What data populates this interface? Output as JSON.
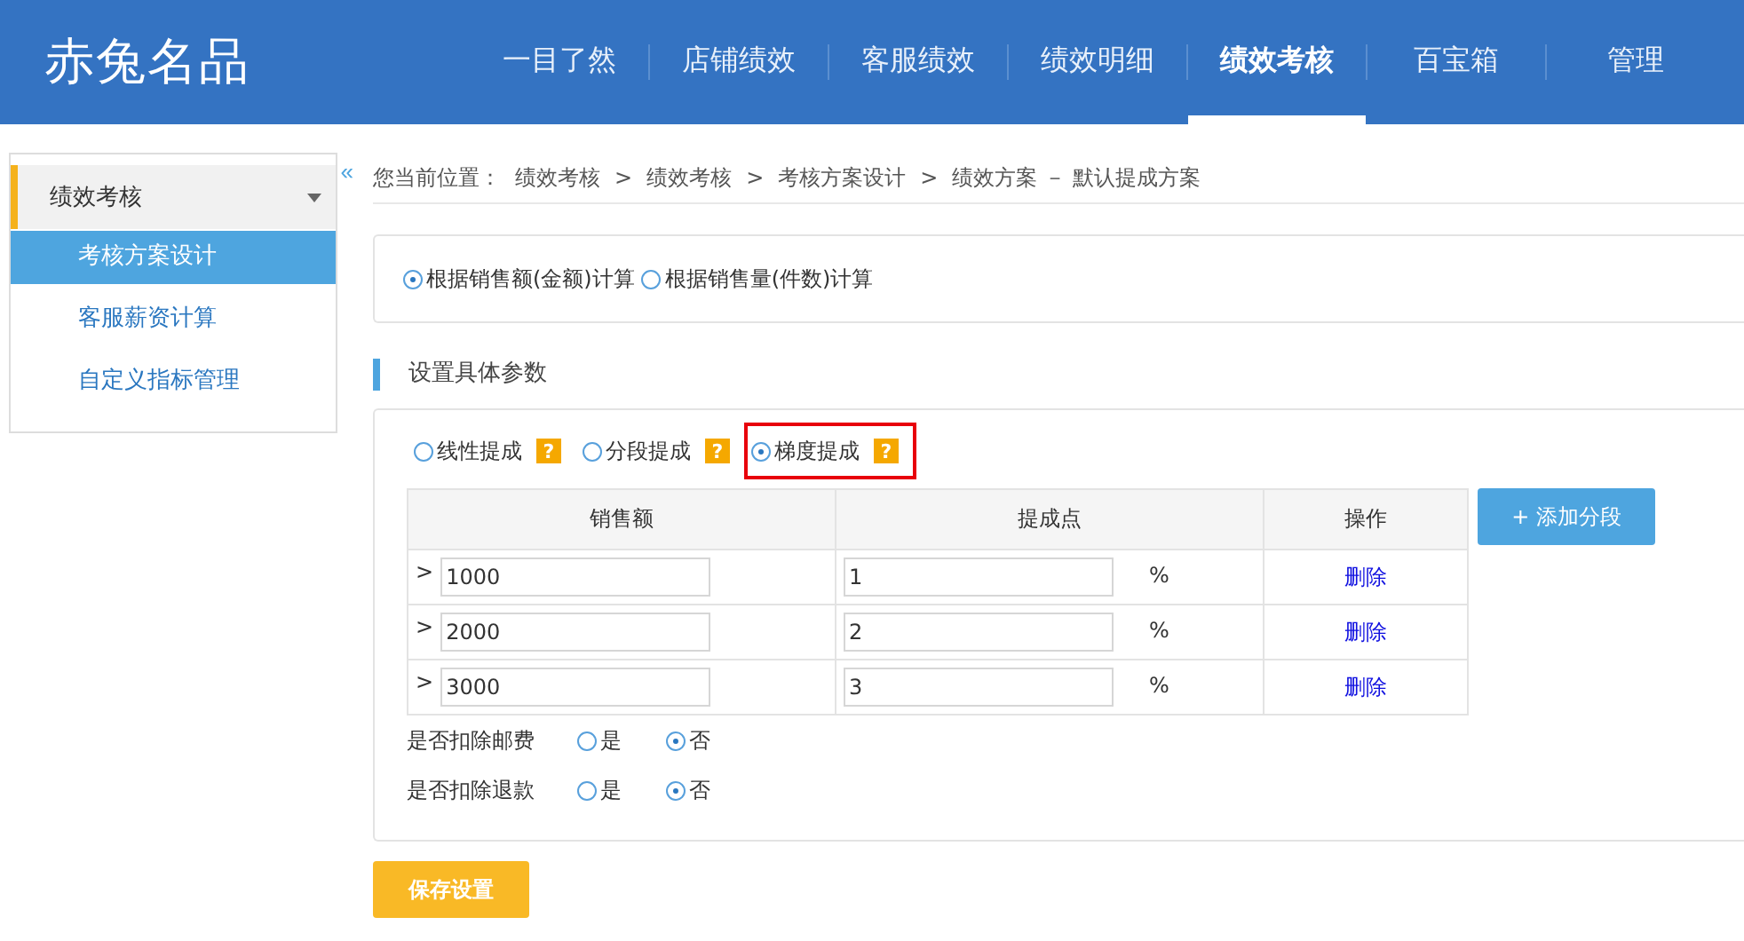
{
  "logo": "赤兔名品",
  "nav": [
    {
      "label": "一目了然",
      "selected": false
    },
    {
      "label": "店铺绩效",
      "selected": false
    },
    {
      "label": "客服绩效",
      "selected": false
    },
    {
      "label": "绩效明细",
      "selected": false
    },
    {
      "label": "绩效考核",
      "selected": true
    },
    {
      "label": "百宝箱",
      "selected": false
    },
    {
      "label": "管理",
      "selected": false
    }
  ],
  "sidebar": {
    "group": {
      "label": "绩效考核",
      "expanded": true
    },
    "collapse": "«",
    "items": [
      {
        "label": "考核方案设计",
        "selected": true
      },
      {
        "label": "客服薪资计算",
        "selected": false
      },
      {
        "label": "自定义指标管理",
        "selected": false
      }
    ]
  },
  "breadcrumb": {
    "prefix": "您当前位置：",
    "separator": ">",
    "items": [
      "绩效考核",
      "绩效考核",
      "考核方案设计",
      "绩效方案 － 默认提成方案"
    ]
  },
  "basis": [
    {
      "label": "根据销售额(金额)计算",
      "selected": true
    },
    {
      "label": "根据销售量(件数)计算",
      "selected": false
    }
  ],
  "section_title": "设置具体参数",
  "methods": [
    {
      "label": "线性提成",
      "help": "?",
      "selected": false,
      "highlighted": false
    },
    {
      "label": "分段提成",
      "help": "?",
      "selected": false,
      "highlighted": false
    },
    {
      "label": "梯度提成",
      "help": "?",
      "selected": true,
      "highlighted": true
    }
  ],
  "table": {
    "columns": [
      "销售额",
      "提成点",
      "操作"
    ],
    "rows": [
      {
        "prefix": ">",
        "amount": "1000",
        "rate": "1",
        "unit": "%",
        "action": "删除"
      },
      {
        "prefix": ">",
        "amount": "2000",
        "rate": "2",
        "unit": "%",
        "action": "删除"
      },
      {
        "prefix": ">",
        "amount": "3000",
        "rate": "3",
        "unit": "%",
        "action": "删除"
      }
    ]
  },
  "add_button": "+ 添加分段",
  "options": [
    {
      "label": "是否扣除邮费",
      "choices": [
        {
          "label": "是",
          "selected": false
        },
        {
          "label": "否",
          "selected": true
        }
      ]
    },
    {
      "label": "是否扣除退款",
      "choices": [
        {
          "label": "是",
          "selected": false
        },
        {
          "label": "否",
          "selected": true
        }
      ]
    }
  ],
  "save_button": "保存设置"
}
